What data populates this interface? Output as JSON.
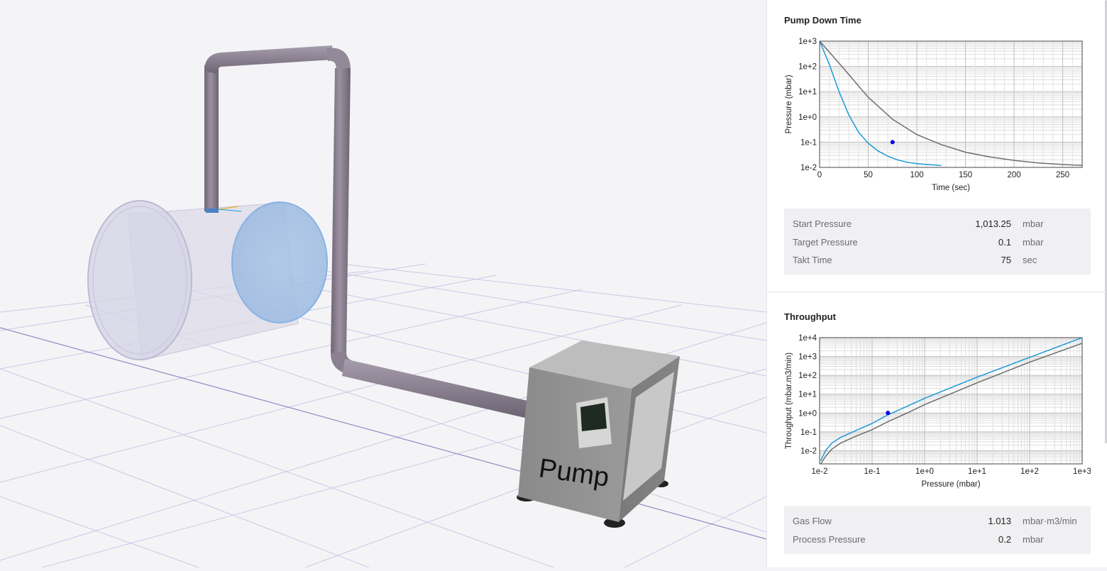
{
  "scene": {
    "pump_label": "Pump"
  },
  "pumpdown": {
    "title": "Pump Down Time",
    "chart_data": {
      "type": "line",
      "xlabel": "Time (sec)",
      "ylabel": "Pressure (mbar)",
      "xlim": [
        0,
        270
      ],
      "ylim_log10": [
        -2,
        3
      ],
      "ylog": true,
      "xticks": [
        0,
        50,
        100,
        150,
        200,
        250
      ],
      "xtick_labels": [
        "0",
        "50",
        "100",
        "150",
        "200",
        "250"
      ],
      "yticks": [
        3,
        2,
        1,
        0,
        -1,
        -2
      ],
      "ytick_labels": [
        "1e+3",
        "1e+2",
        "1e+1",
        "1e+0",
        "1e-1",
        "1e-2"
      ],
      "grid": true,
      "series": [
        {
          "color": "#1a9ad6",
          "x": [
            0,
            10,
            20,
            30,
            40,
            50,
            60,
            70,
            80,
            90,
            100,
            110,
            125
          ],
          "y": [
            1013,
            120,
            10,
            1.2,
            0.25,
            0.09,
            0.045,
            0.028,
            0.02,
            0.016,
            0.014,
            0.013,
            0.012
          ]
        },
        {
          "color": "#6d6d6d",
          "x": [
            0,
            25,
            50,
            75,
            100,
            125,
            150,
            175,
            200,
            225,
            250,
            270
          ],
          "y": [
            1013,
            80,
            6,
            0.8,
            0.2,
            0.08,
            0.04,
            0.026,
            0.019,
            0.015,
            0.013,
            0.012
          ]
        }
      ],
      "points": [
        {
          "x": 75,
          "y": 0.1,
          "color": "#0000e6"
        }
      ]
    },
    "info": [
      {
        "label": "Start Pressure",
        "value": "1,013.25",
        "unit": "mbar"
      },
      {
        "label": "Target Pressure",
        "value": "0.1",
        "unit": "mbar"
      },
      {
        "label": "Takt Time",
        "value": "75",
        "unit": "sec"
      }
    ]
  },
  "throughput": {
    "title": "Throughput",
    "chart_data": {
      "type": "line",
      "xlabel": "Pressure (mbar)",
      "ylabel": "Throughput (mbar.m3/min)",
      "xlog": true,
      "ylog": true,
      "xlim_log10": [
        -2,
        3
      ],
      "ylim_log10": [
        -2.7,
        4
      ],
      "xticks": [
        -2,
        -1,
        0,
        1,
        2,
        3
      ],
      "xtick_labels": [
        "1e-2",
        "1e-1",
        "1e+0",
        "1e+1",
        "1e+2",
        "1e+3"
      ],
      "yticks": [
        4,
        3,
        2,
        1,
        0,
        -1,
        -2
      ],
      "ytick_labels": [
        "1e+4",
        "1e+3",
        "1e+2",
        "1e+1",
        "1e+0",
        "1e-1",
        "1e-2"
      ],
      "grid": true,
      "series": [
        {
          "color": "#1a9ad6",
          "x": [
            0.0105,
            0.013,
            0.017,
            0.025,
            0.05,
            0.1,
            0.2,
            0.5,
            1,
            10,
            100,
            1000
          ],
          "y": [
            0.003,
            0.01,
            0.025,
            0.05,
            0.12,
            0.28,
            0.8,
            2.5,
            6,
            80,
            900,
            10000
          ]
        },
        {
          "color": "#6d6d6d",
          "x": [
            0.0105,
            0.013,
            0.017,
            0.025,
            0.05,
            0.1,
            0.2,
            0.5,
            1,
            10,
            100,
            1000
          ],
          "y": [
            0.002,
            0.005,
            0.012,
            0.025,
            0.06,
            0.13,
            0.35,
            1.1,
            2.8,
            40,
            500,
            5000
          ]
        }
      ],
      "points": [
        {
          "x": 0.2,
          "y": 1.013,
          "color": "#0000e6"
        }
      ]
    },
    "info": [
      {
        "label": "Gas Flow",
        "value": "1.013",
        "unit": "mbar·m3/min"
      },
      {
        "label": "Process Pressure",
        "value": "0.2",
        "unit": "mbar"
      }
    ]
  }
}
